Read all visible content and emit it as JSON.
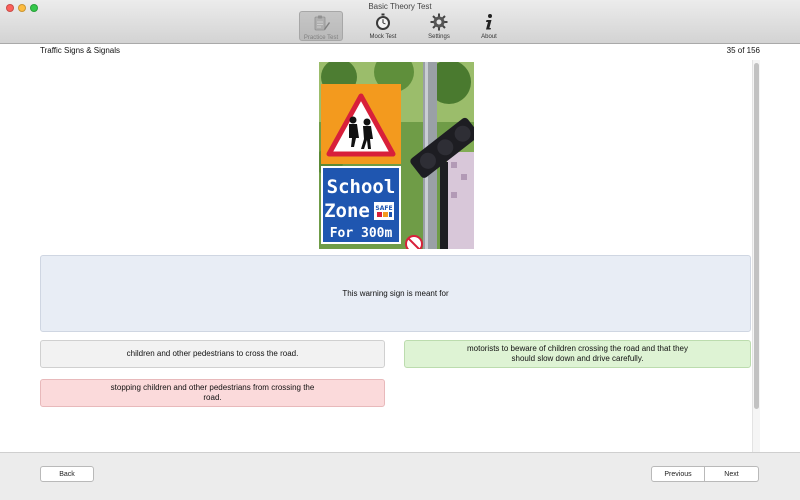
{
  "window": {
    "title": "Basic Theory Test"
  },
  "toolbar": {
    "items": [
      {
        "label": "Practice Test",
        "icon": "clipboard-pencil-icon",
        "active": true
      },
      {
        "label": "Mock Test",
        "icon": "stopwatch-icon",
        "active": false
      },
      {
        "label": "Settings",
        "icon": "gear-icon",
        "active": false
      },
      {
        "label": "About",
        "icon": "info-icon",
        "active": false
      }
    ]
  },
  "header": {
    "section": "Traffic Signs & Signals",
    "counter": "35 of 156"
  },
  "sign": {
    "line1": "School",
    "line2": "Zone",
    "line3": "For 300m",
    "badge": "SAFE",
    "colors": {
      "orange": "#f39a1e",
      "blue": "#1f56b0",
      "red": "#d8203a",
      "foliage": "#5c8f3a"
    }
  },
  "question": {
    "text": "This warning sign is meant for"
  },
  "answers": [
    {
      "text": "children and other pedestrians to cross the road.",
      "state": "neutral",
      "color": "#f2f2f2"
    },
    {
      "text": "motorists to beware of children crossing the road and that they should slow down and drive carefully.",
      "state": "correct",
      "color": "#def3d4"
    },
    {
      "text": "stopping children and other pedestrians from crossing the road.",
      "state": "wrong",
      "color": "#fbdadb"
    }
  ],
  "footer": {
    "back": "Back",
    "previous": "Previous",
    "next": "Next"
  }
}
